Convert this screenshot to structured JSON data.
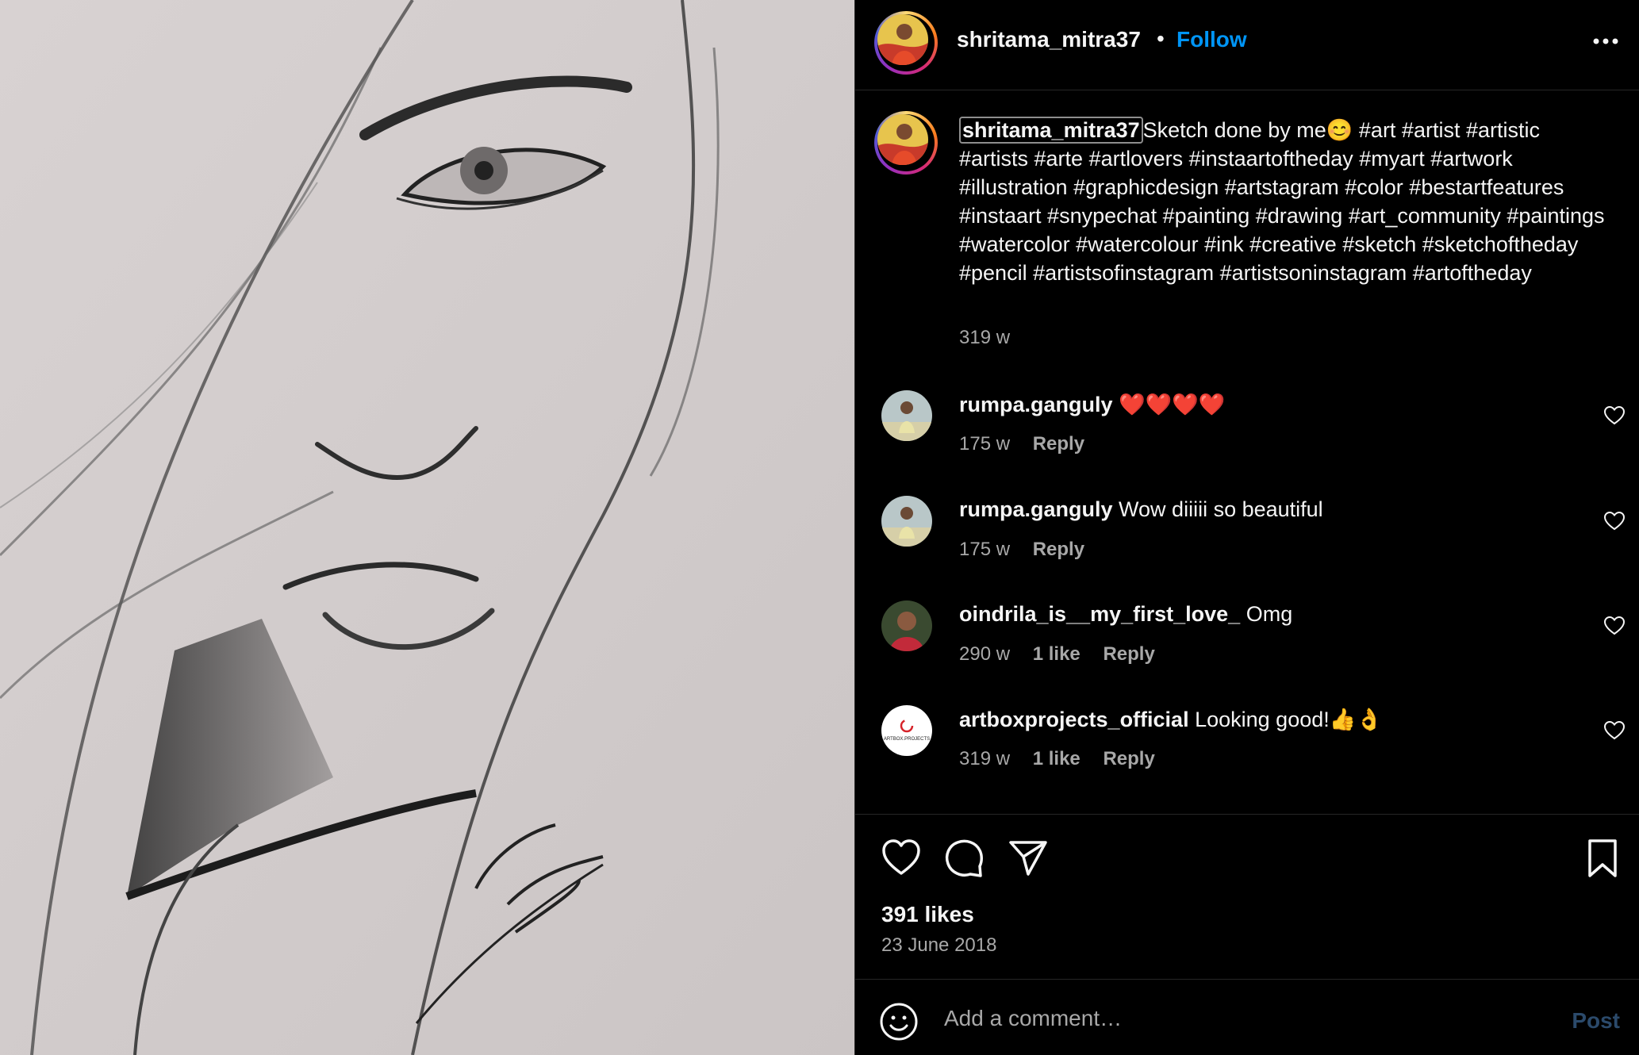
{
  "post": {
    "author": "shritama_mitra37",
    "separator": "•",
    "follow_label": "Follow",
    "more_label": "More options",
    "caption_user": "shritama_mitra37",
    "caption_body": "Sketch done by me",
    "caption_emoji": "😊",
    "caption_tags_line1": "#art #artist #artistic",
    "caption_tags_rest": "#artists #arte #artlovers #instaartoftheday #myart #artwork #illustration #graphicdesign #artstagram #color #bestartfeatures #instaart #snypechat #painting #drawing #art_community #paintings #watercolor #watercolour #ink #creative #sketch #sketchoftheday #pencil #artistsofinstagram #artistsoninstagram #artoftheday",
    "caption_time": "319 w"
  },
  "comments": [
    {
      "user": "rumpa.ganguly",
      "text": "❤️❤️❤️❤️",
      "time": "175 w",
      "likes": "",
      "reply": "Reply"
    },
    {
      "user": "rumpa.ganguly",
      "text": "Wow diiiii so beautiful",
      "time": "175 w",
      "likes": "",
      "reply": "Reply"
    },
    {
      "user": "oindrila_is__my_first_love_",
      "text": "Omg",
      "time": "290 w",
      "likes": "1 like",
      "reply": "Reply"
    },
    {
      "user": "artboxprojects_official",
      "text": "Looking good!👍👌",
      "time": "319 w",
      "likes": "1 like",
      "reply": "Reply"
    }
  ],
  "stats": {
    "likes": "391 likes",
    "date": "23 June 2018"
  },
  "composer": {
    "placeholder": "Add a comment…",
    "post_label": "Post"
  },
  "artbox_logo_text": "ARTBOX.PROJECTS",
  "colors": {
    "accent": "#0095f6",
    "background": "#000000",
    "muted": "#a8a8a8",
    "sketch_paper": "#d2cccc"
  }
}
